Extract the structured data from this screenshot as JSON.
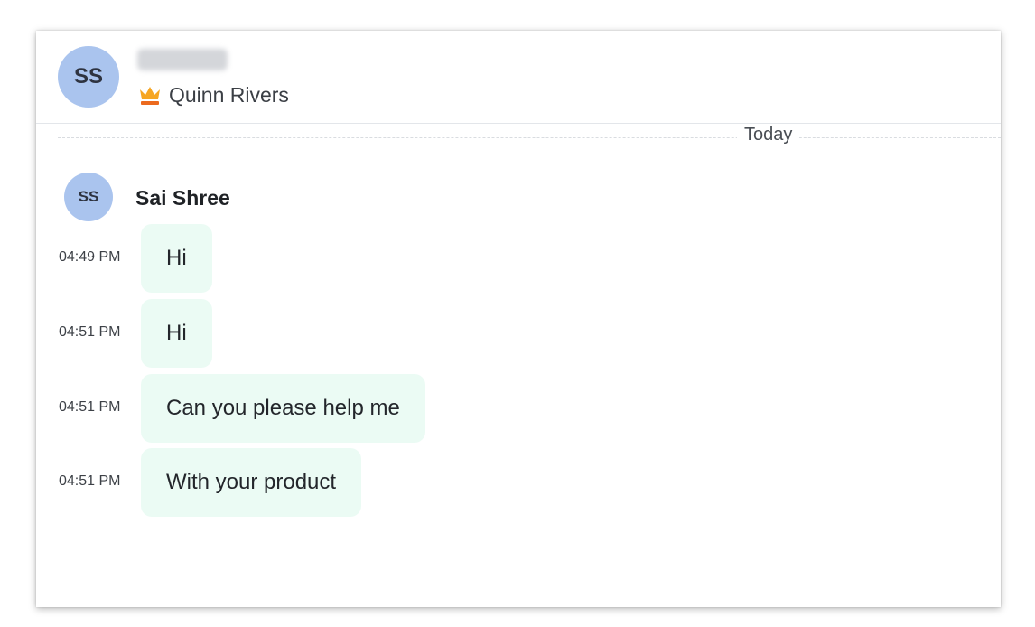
{
  "header": {
    "avatar_initials": "SS",
    "agent_name": "Quinn Rivers",
    "crown_icon": "crown-icon",
    "crown_colors": {
      "top": "#f6a623",
      "base": "#ec6a1e"
    }
  },
  "divider": {
    "label": "Today"
  },
  "sender": {
    "avatar_initials": "SS",
    "name": "Sai Shree"
  },
  "messages": [
    {
      "time": "04:49 PM",
      "text": "Hi"
    },
    {
      "time": "04:51 PM",
      "text": "Hi"
    },
    {
      "time": "04:51 PM",
      "text": "Can you please help me"
    },
    {
      "time": "04:51 PM",
      "text": "With your product"
    }
  ],
  "colors": {
    "avatar_bg": "#aac4ee",
    "bubble_bg": "#ebfbf4"
  }
}
